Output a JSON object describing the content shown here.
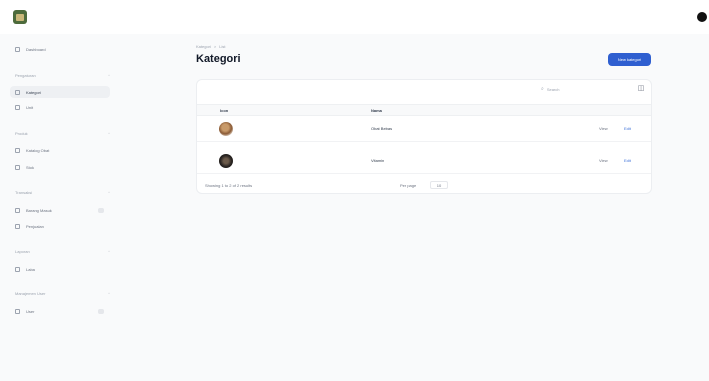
{
  "topbar": {
    "logo_icon": "plant-logo-icon",
    "avatar_icon": "user-avatar-icon"
  },
  "sidebar": {
    "dashboard": "Dashboard",
    "groups": [
      {
        "label": "Pengaturan",
        "items": [
          {
            "label": "Kategori",
            "icon": "tag-icon",
            "active": true
          },
          {
            "label": "Unit",
            "icon": "box-icon",
            "active": false
          }
        ]
      },
      {
        "label": "Produk",
        "items": [
          {
            "label": "Katalog Obat",
            "icon": "book-icon",
            "active": false
          },
          {
            "label": "Stok",
            "icon": "archive-icon",
            "active": false
          }
        ]
      },
      {
        "label": "Transaksi",
        "items": [
          {
            "label": "Barang Masuk",
            "icon": "inbox-icon",
            "active": false,
            "badge": true
          },
          {
            "label": "Penjualan",
            "icon": "cart-icon",
            "active": false
          }
        ]
      },
      {
        "label": "Laporan",
        "items": [
          {
            "label": "Laba",
            "icon": "chart-icon",
            "active": false
          }
        ]
      },
      {
        "label": "Manajemen User",
        "items": [
          {
            "label": "User",
            "icon": "users-icon",
            "active": false,
            "badge": true
          }
        ]
      }
    ]
  },
  "breadcrumb": {
    "parent": "Kategori",
    "separator": ">",
    "current": "List"
  },
  "page": {
    "title": "Kategori",
    "new_button": "New kategori"
  },
  "table": {
    "search_placeholder": "Search",
    "filter_icon": "filter-icon",
    "columns": {
      "image": "Icon",
      "name": "Nama"
    },
    "rows": [
      {
        "name": "Obat Bebas",
        "thumb_color": "#a67c52",
        "view": "View",
        "edit": "Edit"
      },
      {
        "name": "Vitamin",
        "thumb_color": "#2b2623",
        "view": "View",
        "edit": "Edit"
      }
    ],
    "footer": {
      "info": "Showing 1 to 2 of 2 results",
      "per_page_label": "Per page",
      "per_page_value": "10"
    }
  },
  "colors": {
    "primary": "#2f5fd0",
    "active_nav": "#eef0f3"
  }
}
